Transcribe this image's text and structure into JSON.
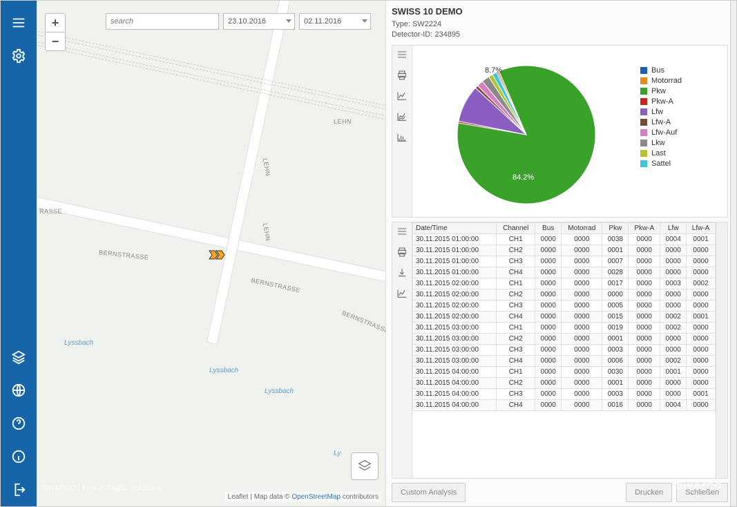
{
  "sidebar": {
    "items_top": [
      "menu",
      "settings"
    ],
    "items_bottom": [
      "layers",
      "globe",
      "help",
      "info",
      "logout"
    ]
  },
  "map": {
    "search_placeholder": "search",
    "date_from": "23.10.2016",
    "date_to": "02.11.2016",
    "zoom_in": "+",
    "zoom_out": "−",
    "roads": [
      "LEHN",
      "LEHN",
      "LEHN",
      "BERNSTRASSE",
      "BERNSTRASSE",
      "BERNSTRASSE",
      "RASSE"
    ],
    "water": [
      "Lyssbach",
      "Lyssbach",
      "Lyssbach",
      "Ly"
    ],
    "attribution_prefix": "Leaflet | Map data © ",
    "attribution_link": "OpenStreetMap",
    "attribution_suffix": " contributors",
    "footer_brand": "SWARCO | First in Traffic Solutions.",
    "logo": "swarco"
  },
  "detail": {
    "title": "SWISS 10 DEMO",
    "type_label": "Type: ",
    "type_value": "SW2224",
    "id_label": "Detector-ID: ",
    "id_value": "234895",
    "buttons": {
      "custom": "Custom Analysis",
      "print": "Drucken",
      "close": "Schließen"
    }
  },
  "chart_data": {
    "type": "pie",
    "title": "",
    "series": [
      {
        "name": "Bus",
        "value": 0.3,
        "color": "#1e5fb4"
      },
      {
        "name": "Motorrad",
        "value": 0.4,
        "color": "#e58a1f"
      },
      {
        "name": "Pkw",
        "value": 84.2,
        "color": "#3aa22a"
      },
      {
        "name": "Pkw-A",
        "value": 0.4,
        "color": "#c2261f"
      },
      {
        "name": "Lfw",
        "value": 8.7,
        "color": "#8b5fc1"
      },
      {
        "name": "Lfw-A",
        "value": 0.7,
        "color": "#7a4a3a"
      },
      {
        "name": "Lfw-Auf",
        "value": 1.5,
        "color": "#d67fc4"
      },
      {
        "name": "Lkw",
        "value": 1.8,
        "color": "#8a8a8a"
      },
      {
        "name": "Last",
        "value": 1.0,
        "color": "#b6c22b"
      },
      {
        "name": "Sattel",
        "value": 1.0,
        "color": "#3fc7d6"
      }
    ],
    "labels_on_chart": [
      "8.7%",
      "84.2%"
    ]
  },
  "table": {
    "columns": [
      "Date/Time",
      "Channel",
      "Bus",
      "Motorrad",
      "Pkw",
      "Pkw-A",
      "Lfw",
      "Lfw-A"
    ],
    "rows": [
      [
        "30.11.2015 01:00:00",
        "CH1",
        "0000",
        "0000",
        "0038",
        "0000",
        "0004",
        "0001"
      ],
      [
        "30.11.2015 01:00:00",
        "CH2",
        "0000",
        "0000",
        "0001",
        "0000",
        "0000",
        "0000"
      ],
      [
        "30.11.2015 01:00:00",
        "CH3",
        "0000",
        "0000",
        "0007",
        "0000",
        "0000",
        "0000"
      ],
      [
        "30.11.2015 01:00:00",
        "CH4",
        "0000",
        "0000",
        "0028",
        "0000",
        "0000",
        "0000"
      ],
      [
        "30.11.2015 02:00:00",
        "CH1",
        "0000",
        "0000",
        "0017",
        "0000",
        "0003",
        "0002"
      ],
      [
        "30.11.2015 02:00:00",
        "CH2",
        "0000",
        "0000",
        "0000",
        "0000",
        "0000",
        "0000"
      ],
      [
        "30.11.2015 02:00:00",
        "CH3",
        "0000",
        "0000",
        "0005",
        "0000",
        "0000",
        "0000"
      ],
      [
        "30.11.2015 02:00:00",
        "CH4",
        "0000",
        "0000",
        "0015",
        "0000",
        "0002",
        "0001"
      ],
      [
        "30.11.2015 03:00:00",
        "CH1",
        "0000",
        "0000",
        "0019",
        "0000",
        "0002",
        "0000"
      ],
      [
        "30.11.2015 03:00:00",
        "CH2",
        "0000",
        "0000",
        "0001",
        "0000",
        "0000",
        "0000"
      ],
      [
        "30.11.2015 03:00:00",
        "CH3",
        "0000",
        "0000",
        "0003",
        "0000",
        "0000",
        "0000"
      ],
      [
        "30.11.2015 03:00:00",
        "CH4",
        "0000",
        "0000",
        "0006",
        "0000",
        "0002",
        "0000"
      ],
      [
        "30.11.2015 04:00:00",
        "CH1",
        "0000",
        "0000",
        "0030",
        "0000",
        "0001",
        "0000"
      ],
      [
        "30.11.2015 04:00:00",
        "CH2",
        "0000",
        "0000",
        "0001",
        "0000",
        "0000",
        "0000"
      ],
      [
        "30.11.2015 04:00:00",
        "CH3",
        "0000",
        "0000",
        "0003",
        "0000",
        "0000",
        "0001"
      ],
      [
        "30.11.2015 04:00:00",
        "CH4",
        "0000",
        "0000",
        "0016",
        "0000",
        "0004",
        "0000"
      ]
    ]
  }
}
